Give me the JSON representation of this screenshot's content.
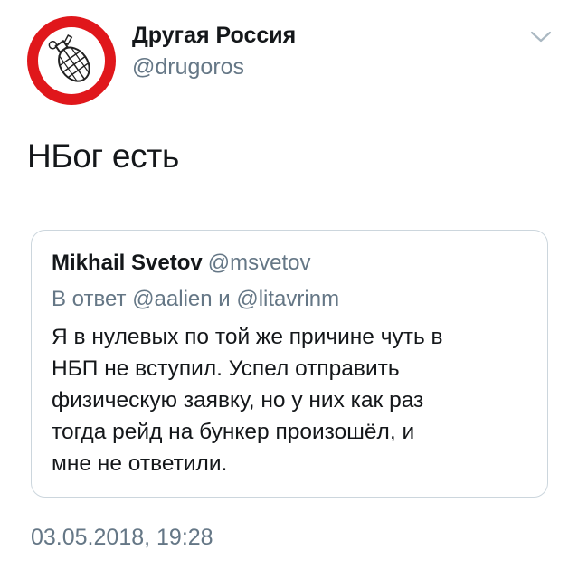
{
  "author": {
    "display_name": "Другая Россия",
    "handle": "@drugoros",
    "avatar_icon": "grenade-logo-icon",
    "brand_color": "#e0171b"
  },
  "menu_icon": "chevron-down-icon",
  "tweet": {
    "text": "НБог есть",
    "timestamp": "03.05.2018, 19:28"
  },
  "quoted_tweet": {
    "author_name": "Mikhail Svetov",
    "author_handle": "@msvetov",
    "reply_prefix": "В ответ",
    "reply_mention_1": "@aalien",
    "reply_conjunction": "и",
    "reply_mention_2": "@litavrinm",
    "body_lines": [
      "Я в нулевых по той же причине чуть в",
      "НБП не вступил. Успел отправить",
      "физическую заявку, но у них как раз",
      "тогда рейд на бункер произошёл, и",
      "мне не ответили."
    ]
  },
  "colors": {
    "text_primary": "#14171a",
    "text_secondary": "#657786",
    "border": "#ccd6dd"
  }
}
